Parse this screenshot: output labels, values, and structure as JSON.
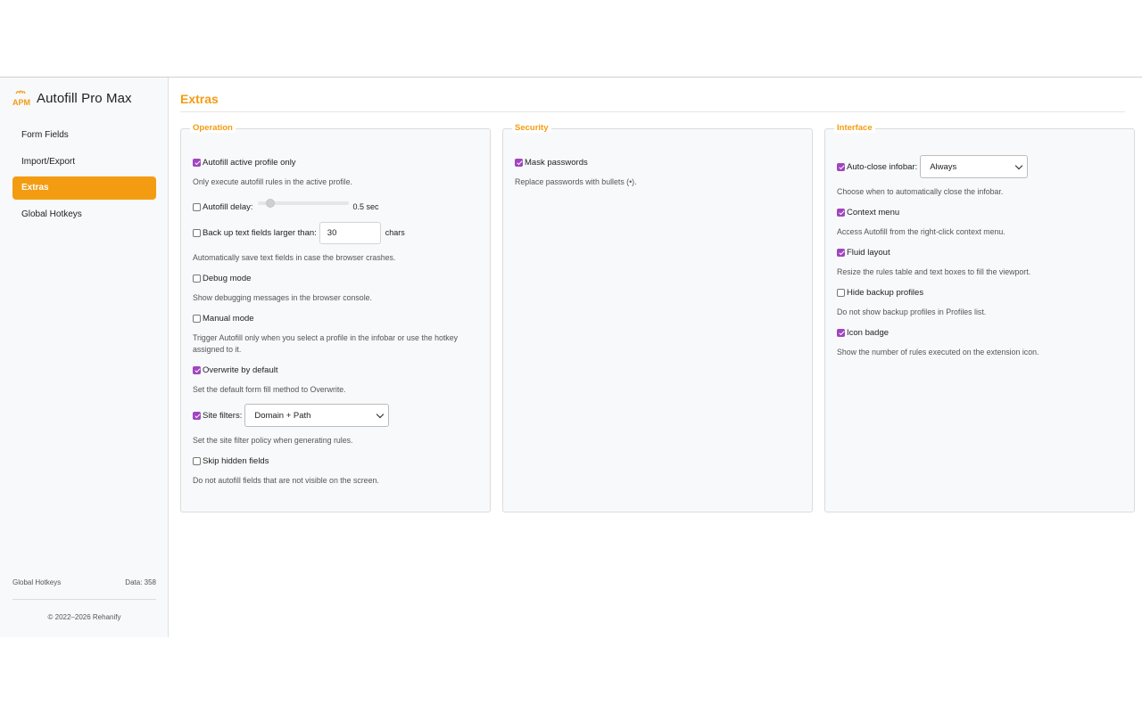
{
  "sidebar": {
    "brand_title": "Autofill Pro Max",
    "logo_text": "APM",
    "nav": [
      {
        "label": "Form Fields"
      },
      {
        "label": "Import/Export"
      },
      {
        "label": "Extras"
      },
      {
        "label": "Global Hotkeys"
      }
    ],
    "active_index": 2,
    "footer_left": "Global Hotkeys",
    "footer_right": "Data: 358",
    "copyright": "© 2022–2026 Rehanify"
  },
  "page": {
    "title": "Extras"
  },
  "operation": {
    "legend": "Operation",
    "autofill_active_label": "Autofill active profile only",
    "autofill_active_checked": true,
    "autofill_active_desc": "Only execute autofill rules in the active profile.",
    "autofill_delay_label": "Autofill delay:",
    "autofill_delay_checked": false,
    "autofill_delay_value": "0.5 sec",
    "autofill_delay_level": 0.1,
    "backup_label": "Back up text fields larger than:",
    "backup_checked": false,
    "backup_value": "30",
    "backup_unit": "chars",
    "backup_desc": "Automatically save text fields in case the browser crashes.",
    "debug_label": "Debug mode",
    "debug_checked": false,
    "debug_desc": "Show debugging messages in the browser console.",
    "manual_label": "Manual mode",
    "manual_checked": false,
    "manual_desc": "Trigger Autofill only when you select a profile in the infobar or use the hotkey assigned to it.",
    "overwrite_label": "Overwrite by default",
    "overwrite_checked": true,
    "overwrite_desc": "Set the default form fill method to Overwrite.",
    "site_filters_label": "Site filters:",
    "site_filters_checked": true,
    "site_filters_value": "Domain + Path",
    "site_filters_desc": "Set the site filter policy when generating rules.",
    "skip_hidden_label": "Skip hidden fields",
    "skip_hidden_checked": false,
    "skip_hidden_desc": "Do not autofill fields that are not visible on the screen."
  },
  "security": {
    "legend": "Security",
    "mask_label": "Mask passwords",
    "mask_checked": true,
    "mask_desc": "Replace passwords with bullets (•)."
  },
  "interface": {
    "legend": "Interface",
    "auto_close_label": "Auto-close infobar:",
    "auto_close_checked": true,
    "auto_close_value": "Always",
    "auto_close_desc": "Choose when to automatically close the infobar.",
    "context_label": "Context menu",
    "context_checked": true,
    "context_desc": "Access Autofill from the right-click context menu.",
    "fluid_label": "Fluid layout",
    "fluid_checked": true,
    "fluid_desc": "Resize the rules table and text boxes to fill the viewport.",
    "hide_backup_label": "Hide backup profiles",
    "hide_backup_checked": false,
    "hide_backup_desc": "Do not show backup profiles in Profiles list.",
    "icon_badge_label": "Icon badge",
    "icon_badge_checked": true,
    "icon_badge_desc": "Show the number of rules executed on the extension icon."
  },
  "colors": {
    "accent": "#f39c12",
    "checkbox": "#a045c0"
  }
}
